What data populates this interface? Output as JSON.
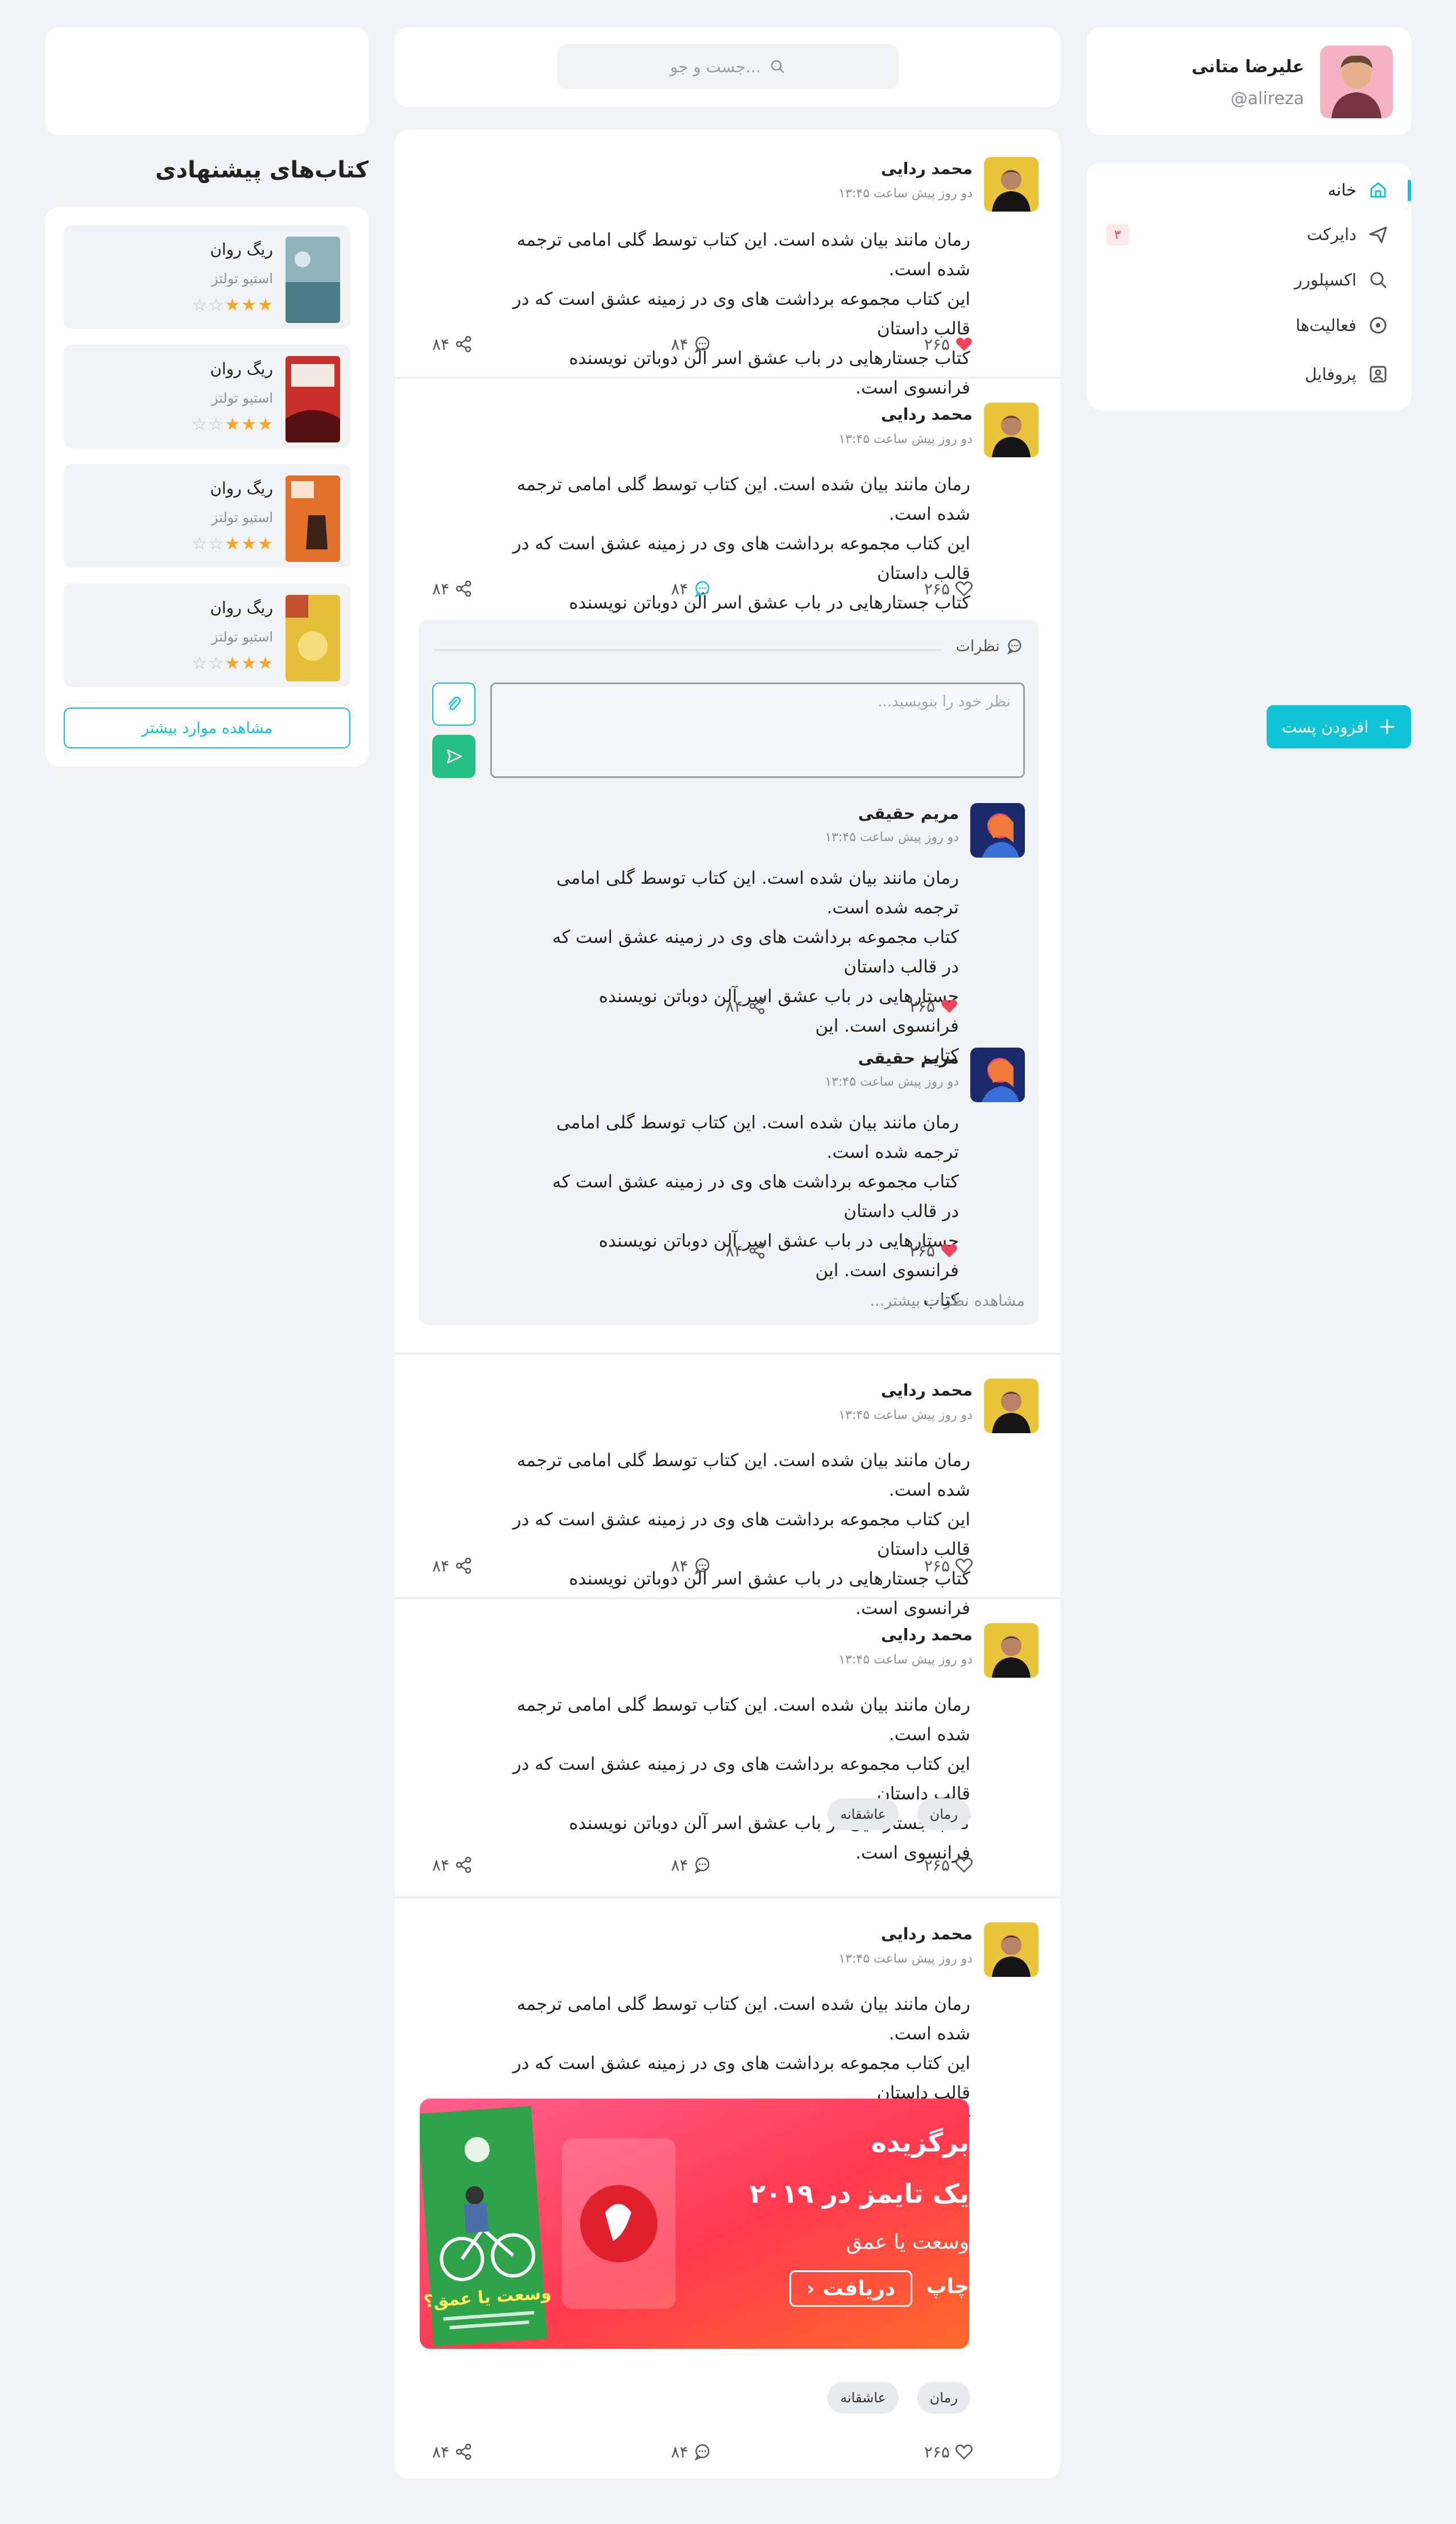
{
  "user": {
    "name": "علیرضا متانی",
    "handle": "@alireza"
  },
  "nav": [
    {
      "label": "خانه",
      "icon": "home-icon"
    },
    {
      "label": "دایرکت",
      "icon": "send-icon",
      "badge": "۳"
    },
    {
      "label": "اکسپلورر",
      "icon": "search-icon"
    },
    {
      "label": "فعالیت‌ها",
      "icon": "activity-icon"
    },
    {
      "label": "پروفایل",
      "icon": "profile-icon"
    }
  ],
  "add_post": "افزودن پست",
  "search": {
    "placeholder": "جست و جو..."
  },
  "books": {
    "title": "کتاب‌های پیشنهادی",
    "items": [
      {
        "title": "ریگ روان",
        "author": "استیو تولتز",
        "rating": 3
      },
      {
        "title": "ریگ روان",
        "author": "استیو تولتز",
        "rating": 3
      },
      {
        "title": "ریگ روان",
        "author": "استیو تولتز",
        "rating": 3
      },
      {
        "title": "ریگ روان",
        "author": "استیو تولتز",
        "rating": 3
      }
    ],
    "more": "مشاهده موارد بیشتر"
  },
  "post": {
    "author": "محمد ردایی",
    "time": "دو روز پیش ساعت ۱۳:۴۵",
    "lines": [
      "رمان مانند بیان شده است. این کتاب توسط گلی امامی ترجمه شده است.",
      "این کتاب مجموعه برداشت های وی در زمینه عشق است که در قالب داستان",
      "کتاب جستارهایی در باب عشق اسر آلن دوباتن نویسنده فرانسوی است."
    ],
    "likes": "۲۶۵",
    "comments": "۸۴",
    "shares": "۸۴"
  },
  "tags": [
    "رمان",
    "عاشقانه"
  ],
  "comments_section": {
    "heading": "نظرات",
    "input_placeholder": "نظر خود را بنویسید...",
    "more": "مشاهده نظرات بیشتر...",
    "items": [
      {
        "author": "مریم حقیقی",
        "time": "دو روز پیش ساعت ۱۳:۴۵",
        "lines": [
          "رمان مانند بیان شده است. این کتاب توسط گلی امامی ترجمه شده است.",
          "کتاب مجموعه برداشت های وی در زمینه عشق است که در قالب داستان",
          "جستارهایی در باب عشق اسر آلن دوباتن نویسنده فرانسوی است. این",
          "کتاب"
        ],
        "likes": "۲۶۵",
        "shares": "۸۴"
      },
      {
        "author": "مریم حقیقی",
        "time": "دو روز پیش ساعت ۱۳:۴۵",
        "lines": [
          "رمان مانند بیان شده است. این کتاب توسط گلی امامی ترجمه شده است.",
          "کتاب مجموعه برداشت های وی در زمینه عشق است که در قالب داستان",
          "جستارهایی در باب عشق اسر آلن دوباتن نویسنده فرانسوی است. این",
          "کتاب"
        ],
        "likes": "۲۶۵",
        "shares": "۸۴"
      }
    ]
  },
  "banner": {
    "line1": "برگزیده",
    "line2": "یک تایمز در ۲۰۱۹",
    "line3": "وسعت یا عمق",
    "button": "دریافت",
    "chap": "چاپ",
    "book_title": "وسعت یا عمق؟"
  },
  "colors": {
    "accent": "#12c3d8",
    "like": "#f0445a",
    "send": "#26c084"
  }
}
